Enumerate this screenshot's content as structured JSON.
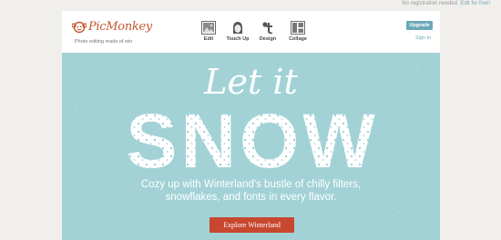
{
  "top_note": {
    "text": "No registration needed.",
    "link": "Edit for free!"
  },
  "logo": {
    "name": "PicMonkey",
    "tagline": "Photo editing made of win",
    "icon": "monkey-logo-icon"
  },
  "toolbar": [
    {
      "label": "Edit",
      "icon": "image-icon"
    },
    {
      "label": "Touch Up",
      "icon": "face-icon"
    },
    {
      "label": "Design",
      "icon": "design-icon"
    },
    {
      "label": "Collage",
      "icon": "collage-icon"
    }
  ],
  "account": {
    "upgrade": "Upgrade",
    "signin": "Sign In"
  },
  "hero": {
    "script_title": "Let it",
    "big_title": "SNOW",
    "body_line1": "Cozy up with Winterland's bustle of chilly filters,",
    "body_line2": "snowflakes, and fonts in every flavor.",
    "cta": "Explore Winterland"
  },
  "colors": {
    "brand": "#c4562f",
    "accent": "#6aa9b8",
    "hero_bg": "#a2d2d6",
    "cta": "#c8472f"
  }
}
